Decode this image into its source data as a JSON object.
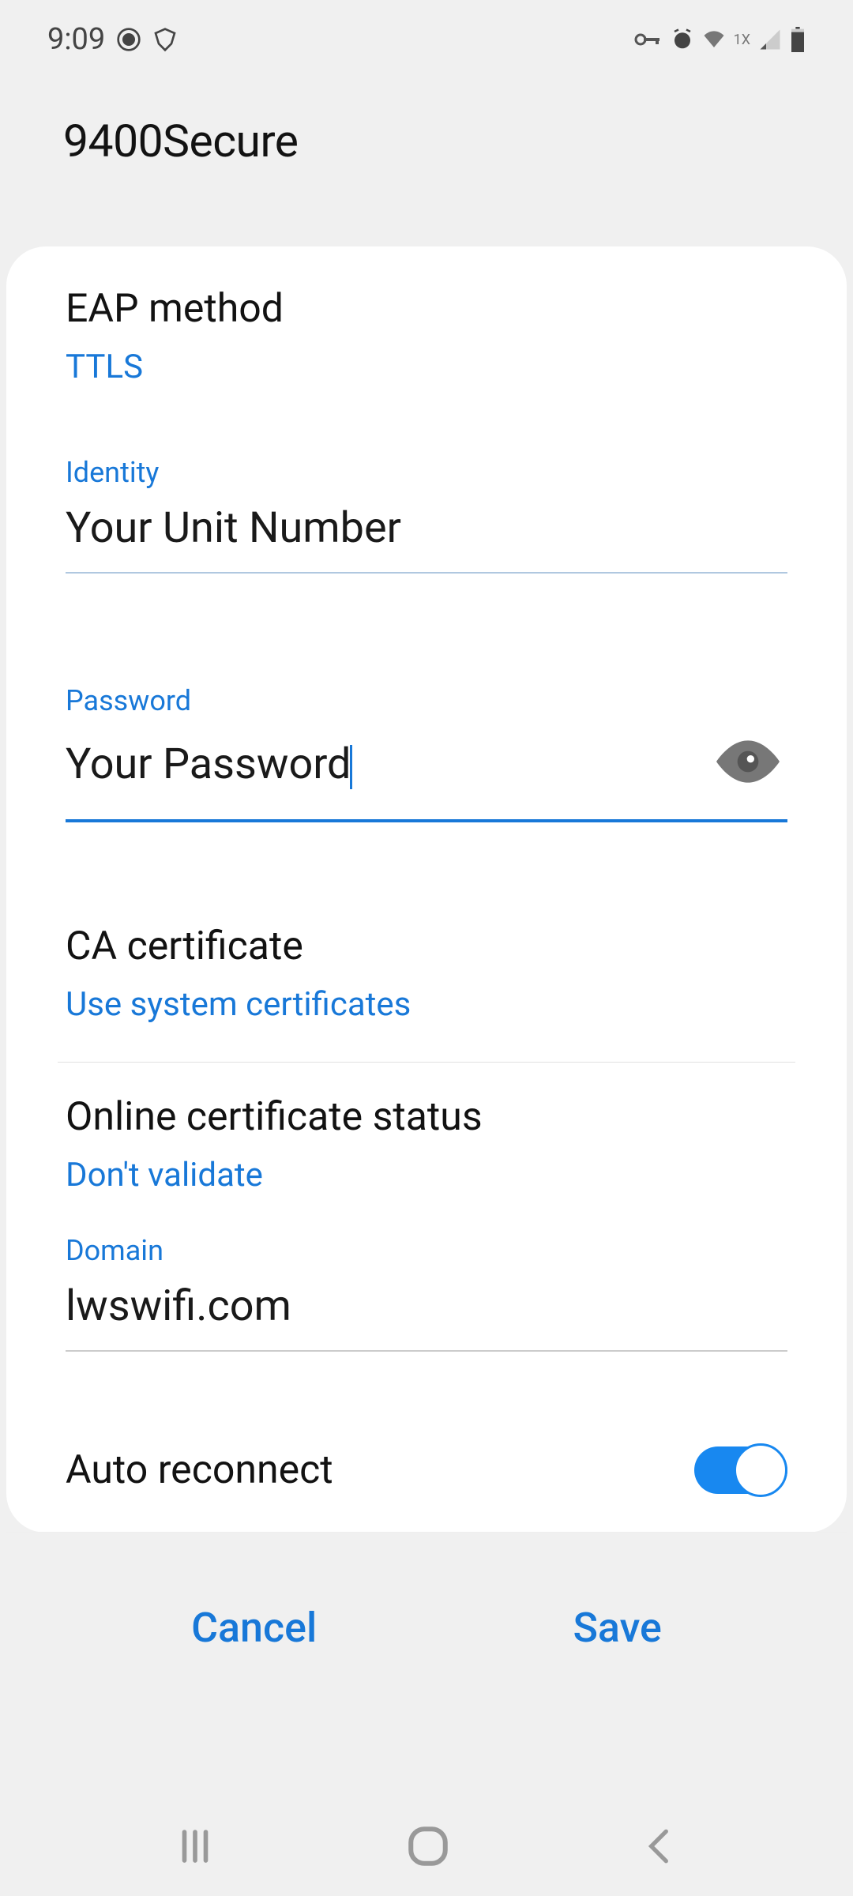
{
  "status_bar": {
    "time": "9:09",
    "signal_label": "1X"
  },
  "page_title": "9400Secure",
  "eap_method": {
    "label": "EAP method",
    "value": "TTLS"
  },
  "identity": {
    "label": "Identity",
    "value": "Your Unit Number"
  },
  "password": {
    "label": "Password",
    "value": "Your Password"
  },
  "ca_cert": {
    "label": "CA certificate",
    "value": "Use system certificates"
  },
  "ocsp": {
    "label": "Online certificate status",
    "value": "Don't validate"
  },
  "domain": {
    "label": "Domain",
    "value": "lwswifi.com"
  },
  "auto_reconnect": {
    "label": "Auto reconnect",
    "enabled": true
  },
  "buttons": {
    "cancel": "Cancel",
    "save": "Save"
  }
}
